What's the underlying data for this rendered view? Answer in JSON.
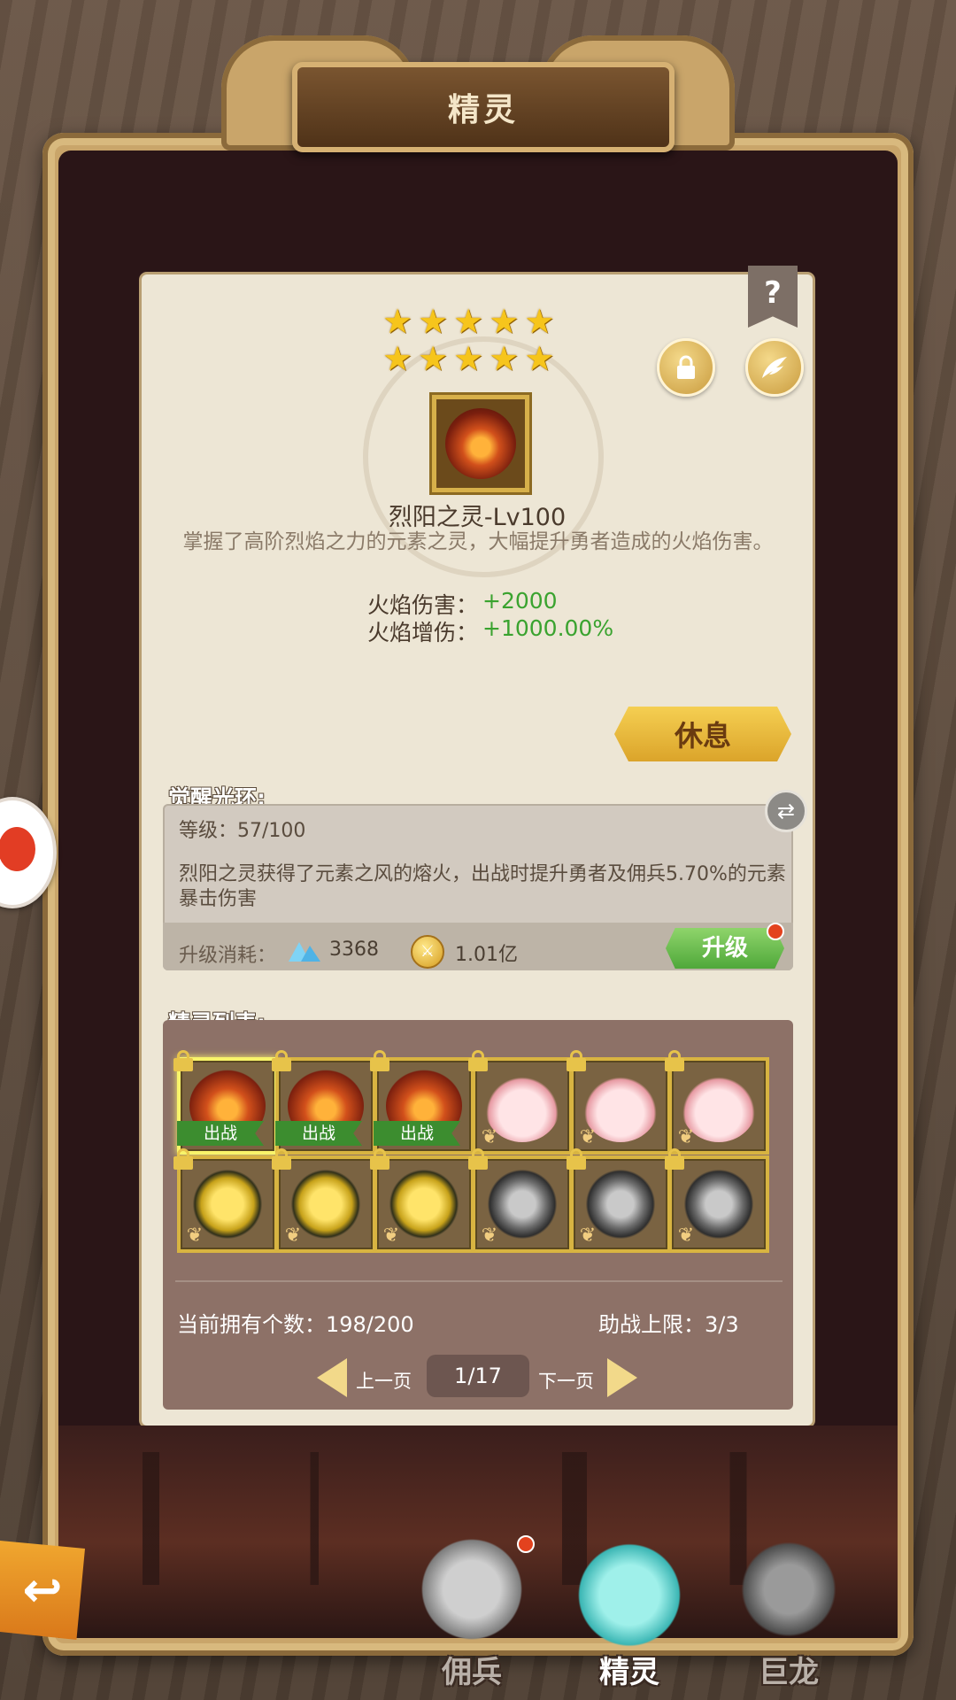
{
  "header": {
    "title": "精灵"
  },
  "spirit": {
    "stars_row1": [
      "★",
      "★",
      "★",
      "★",
      "★"
    ],
    "stars_row2": [
      "★",
      "★",
      "★",
      "★",
      "★"
    ],
    "name": "烈阳之灵-Lv100",
    "description": "掌握了高阶烈焰之力的元素之灵，大幅提升勇者造成的火焰伤害。",
    "stats": [
      {
        "label": "火焰伤害：",
        "value": "+2000"
      },
      {
        "label": "火焰增伤：",
        "value": "+1000.00%"
      }
    ],
    "rest_button": "休息",
    "help_icon": "?"
  },
  "aura": {
    "section_label": "觉醒光环:",
    "level": "等级：57/100",
    "text": "烈阳之灵获得了元素之风的熔火，出战时提升勇者及佣兵5.70%的元素暴击伤害",
    "cost_label": "升级消耗：",
    "crystal_cost": "3368",
    "gold_cost": "1.01亿",
    "upgrade_button": "升级"
  },
  "spirit_list": {
    "section_label": "精灵列表:",
    "deploy_tag": "出战",
    "row1": [
      "fire",
      "fire",
      "fire",
      "pink",
      "pink",
      "pink"
    ],
    "row2": [
      "yellow",
      "yellow",
      "yellow",
      "gray",
      "gray",
      "gray"
    ],
    "owned_count": "当前拥有个数：198/200",
    "assist_limit": "助战上限：3/3",
    "prev_page": "上一页",
    "page_indicator": "1/17",
    "next_page": "下一页"
  },
  "bottom_tabs": [
    {
      "label": "佣兵",
      "icon": "sword-shield-icon",
      "active": false
    },
    {
      "label": "精灵",
      "icon": "spirit-blob-icon",
      "active": true
    },
    {
      "label": "巨龙",
      "icon": "dragon-icon",
      "active": false
    }
  ],
  "colors": {
    "positive_stat": "#3aa32f",
    "accent_gold": "#dba42a",
    "upgrade_green": "#4fa83a"
  }
}
